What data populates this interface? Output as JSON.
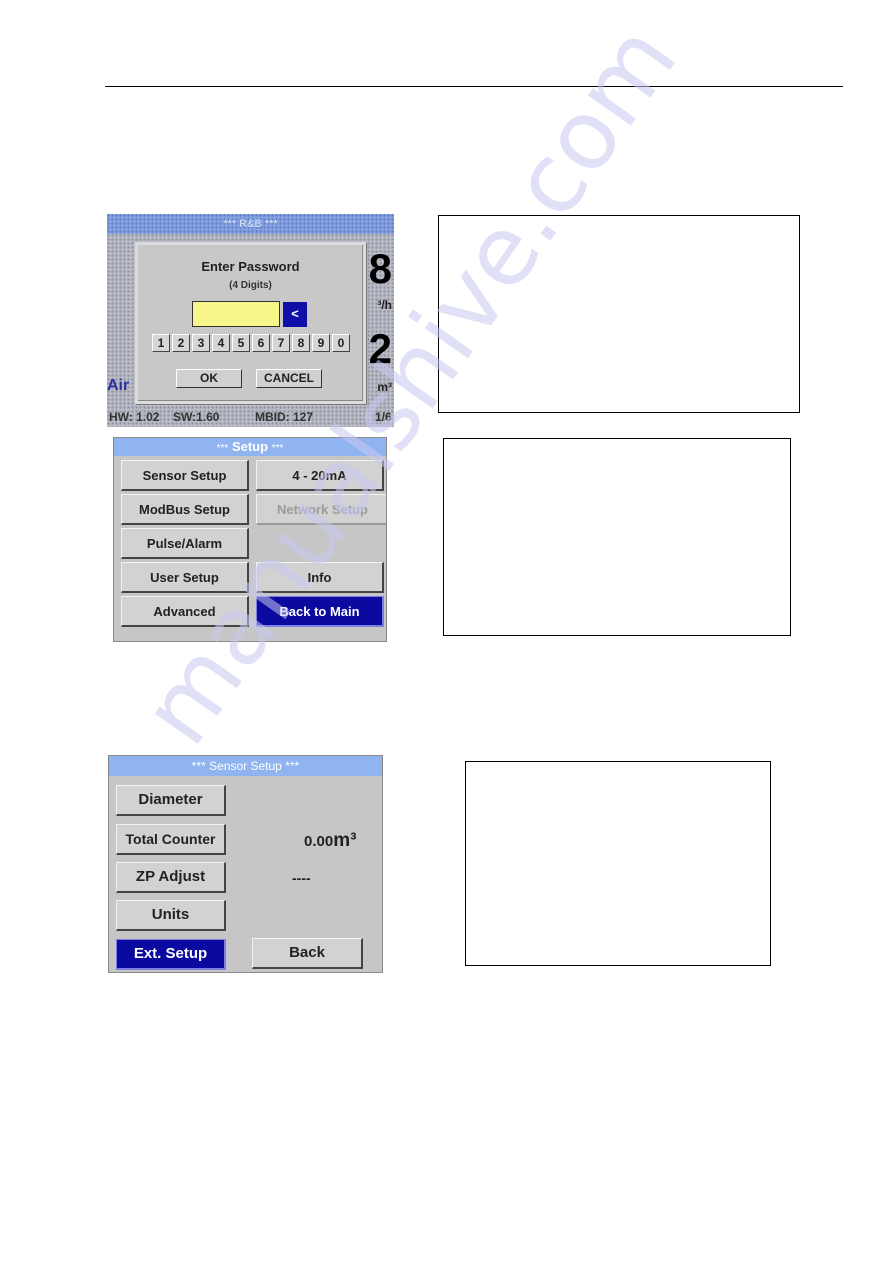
{
  "password_screen": {
    "title": "*** R&B ***",
    "big_value_top": "8",
    "unit_top": "³/h",
    "big_value_bottom": "2",
    "unit_bottom": "m³",
    "label_left": "Air",
    "status": {
      "hw": "HW: 1.02",
      "sw": "SW:1.60",
      "mbid": "MBID: 127",
      "page": "1/6"
    },
    "dialog": {
      "title": "Enter Password",
      "subtitle": "(4 Digits)",
      "field_value": "",
      "backspace_label": "<",
      "digits": [
        "1",
        "2",
        "3",
        "4",
        "5",
        "6",
        "7",
        "8",
        "9",
        "0"
      ],
      "ok_label": "OK",
      "cancel_label": "CANCEL"
    }
  },
  "setup_screen": {
    "title_stars_left": "***",
    "title": "Setup",
    "title_stars_right": "***",
    "buttons": {
      "sensor_setup": "Sensor Setup",
      "ma": "4 - 20mA",
      "modbus_setup": "ModBus Setup",
      "network_setup": "Network Setup",
      "pulse_alarm": "Pulse/Alarm",
      "user_setup": "User Setup",
      "info": "Info",
      "advanced": "Advanced",
      "back_to_main": "Back to Main"
    }
  },
  "sensor_setup_screen": {
    "title": "***   Sensor Setup ***",
    "buttons": {
      "diameter": "Diameter",
      "total_counter": "Total Counter",
      "zp_adjust": "ZP Adjust",
      "units": "Units",
      "ext_setup": "Ext. Setup",
      "back": "Back"
    },
    "total_counter_value": "0.00",
    "total_counter_unit": "m³",
    "zp_adjust_value": "----"
  },
  "watermark": "manualshive.com",
  "colors": {
    "selected_button": "#0a0aa0",
    "title_bar": "#8fb4f0",
    "password_field": "#f6f68a",
    "screen_bg": "#c6c6c6"
  }
}
